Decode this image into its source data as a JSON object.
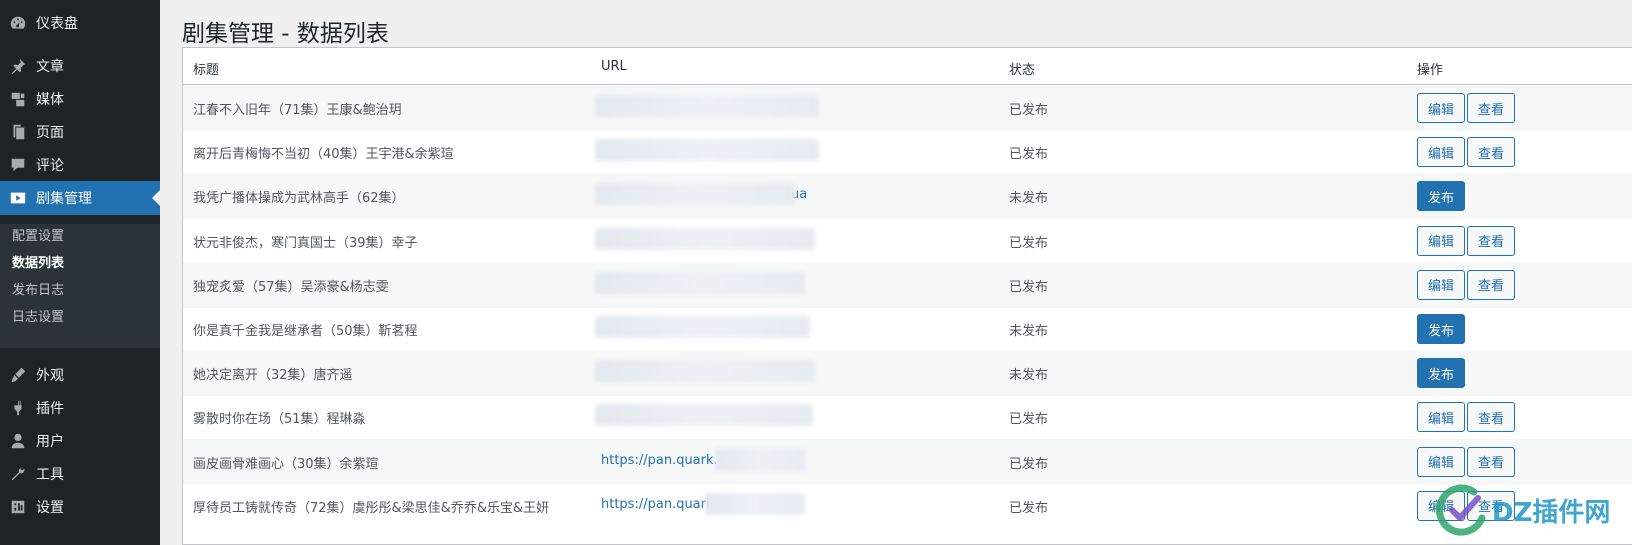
{
  "sidebar": {
    "items": [
      {
        "label": "仪表盘",
        "icon": "dashboard-icon"
      },
      {
        "label": "文章",
        "icon": "pin-icon"
      },
      {
        "label": "媒体",
        "icon": "media-icon"
      },
      {
        "label": "页面",
        "icon": "page-icon"
      },
      {
        "label": "评论",
        "icon": "comment-icon"
      },
      {
        "label": "剧集管理",
        "icon": "video-icon"
      },
      {
        "label": "外观",
        "icon": "brush-icon"
      },
      {
        "label": "插件",
        "icon": "plugin-icon"
      },
      {
        "label": "用户",
        "icon": "user-icon"
      },
      {
        "label": "工具",
        "icon": "wrench-icon"
      },
      {
        "label": "设置",
        "icon": "settings-icon"
      }
    ],
    "submenu": [
      "配置设置",
      "数据列表",
      "发布日志",
      "日志设置"
    ]
  },
  "page": {
    "title": "剧集管理 - 数据列表"
  },
  "table": {
    "headers": [
      "标题",
      "URL",
      "状态",
      "操作"
    ],
    "rows": [
      {
        "title": "江春不入旧年（71集）王康&鲍治玥",
        "url": "",
        "status": "已发布",
        "published": true
      },
      {
        "title": "离开后青梅悔不当初（40集）王宇港&余紫瑄",
        "url": "",
        "status": "已发布",
        "published": true
      },
      {
        "title": "我凭广播体操成为武林高手（62集）",
        "url": "ua",
        "status": "未发布",
        "published": false
      },
      {
        "title": "状元非俊杰，寒门真国士（39集）幸子",
        "url": "",
        "status": "已发布",
        "published": true
      },
      {
        "title": "独宠炙爱（57集）吴添豪&杨志雯",
        "url": "",
        "status": "已发布",
        "published": true
      },
      {
        "title": "你是真千金我是继承者（50集）靳茗程",
        "url": "",
        "status": "未发布",
        "published": false
      },
      {
        "title": "她决定离开（32集）唐齐遥",
        "url": "",
        "status": "未发布",
        "published": false
      },
      {
        "title": "雾散时你在场（51集）程琳淼",
        "url": "",
        "status": "已发布",
        "published": true
      },
      {
        "title": "画皮画骨难画心（30集）余紫瑄",
        "url": "https://pan.quark.cn/s",
        "status": "已发布",
        "published": true
      },
      {
        "title": "厚待员工铸就传奇（72集）虞彤彤&梁思佳&乔乔&乐宝&王妍",
        "url": "https://pan.quark.cn/",
        "status": "已发布",
        "published": true
      }
    ],
    "actions": {
      "edit": "编辑",
      "view": "查看",
      "publish": "发布"
    }
  },
  "watermark": {
    "text": "DZ插件网"
  },
  "colors": {
    "accent": "#2271b1",
    "sidebar_bg": "#1d2327",
    "submenu_bg": "#2c3338"
  }
}
